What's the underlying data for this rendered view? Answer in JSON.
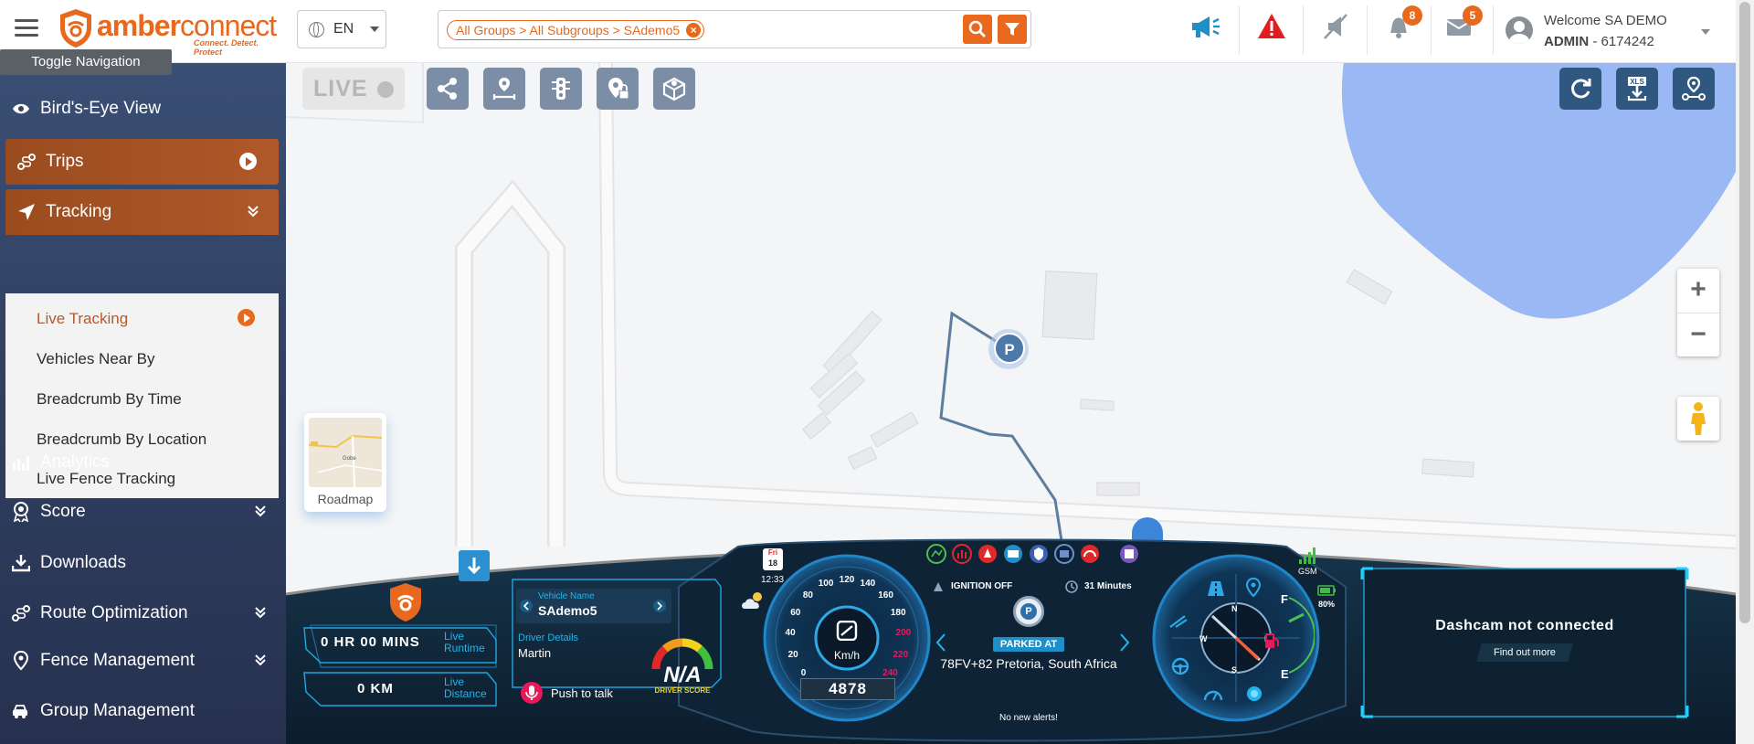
{
  "header": {
    "tooltip": "Toggle Navigation",
    "logo_main": "amber",
    "logo_second": "connect",
    "logo_tagline": "Connect. Detect. Protect",
    "language": "EN",
    "filter_chip": "All Groups > All Subgroups > SAdemo5",
    "announcement_badge": "",
    "notifications_count": "8",
    "messages_count": "5",
    "user_welcome": "Welcome SA DEMO",
    "user_role": "ADMIN",
    "user_id": " - 6174242",
    "accent_color": "#e8681d"
  },
  "sidebar": {
    "items": [
      {
        "label": "Bird's-Eye View",
        "icon": "eye-icon"
      },
      {
        "label": "Trips",
        "icon": "route-icon"
      },
      {
        "label": "Tracking",
        "icon": "navigation-arrow-icon"
      },
      {
        "label": "Analytics",
        "icon": "bar-chart-icon"
      },
      {
        "label": "Score",
        "icon": "award-icon"
      },
      {
        "label": "Downloads",
        "icon": "download-icon"
      },
      {
        "label": "Route Optimization",
        "icon": "route-icon"
      },
      {
        "label": "Fence Management",
        "icon": "map-pin-icon"
      },
      {
        "label": "Group Management",
        "icon": "car-group-icon"
      }
    ],
    "tracking_sub": [
      "Live Tracking",
      "Vehicles Near By",
      "Breadcrumb By Time",
      "Breadcrumb By Location",
      "Live Fence Tracking"
    ]
  },
  "map": {
    "live_label": "LIVE",
    "roadmap_label": "Roadmap",
    "roadmap_thumb_label": "Gobe",
    "parked_marker": "P",
    "zoom_in": "+",
    "zoom_out": "−",
    "xls_label": "XLS"
  },
  "dashboard": {
    "runtime_value": "0 HR 00 MINS",
    "runtime_label_1": "Live",
    "runtime_label_2": "Runtime",
    "distance_value": "0 KM",
    "distance_label_1": "Live",
    "distance_label_2": "Distance",
    "vehicle_name_label": "Vehicle Name",
    "vehicle_name": "SAdemo5",
    "driver_details_label": "Driver Details",
    "driver_name": "Martin",
    "push_to_talk": "Push to talk",
    "driver_score": "N/A",
    "driver_score_label": "DRIVER SCORE",
    "day": "Fri",
    "date": "18",
    "time": "12:33",
    "speed_value": "0",
    "speed_unit": "Km/h",
    "odometer": "4878",
    "speed_ticks": [
      "0",
      "20",
      "40",
      "60",
      "80",
      "100",
      "120",
      "140",
      "160",
      "180",
      "200",
      "220",
      "240"
    ],
    "ignition": "IGNITION OFF",
    "duration": "31 Minutes",
    "status": "PARKED AT",
    "location": "78FV+82 Pretoria, South Africa",
    "alerts": "No new alerts!",
    "gsm_label": "GSM",
    "battery": "80%",
    "compass": [
      "N",
      "E",
      "S",
      "W"
    ],
    "fuel_full": "F",
    "fuel_empty": "E",
    "dashcam_title": "Dashcam not connected",
    "dashcam_link": "Find out more"
  }
}
